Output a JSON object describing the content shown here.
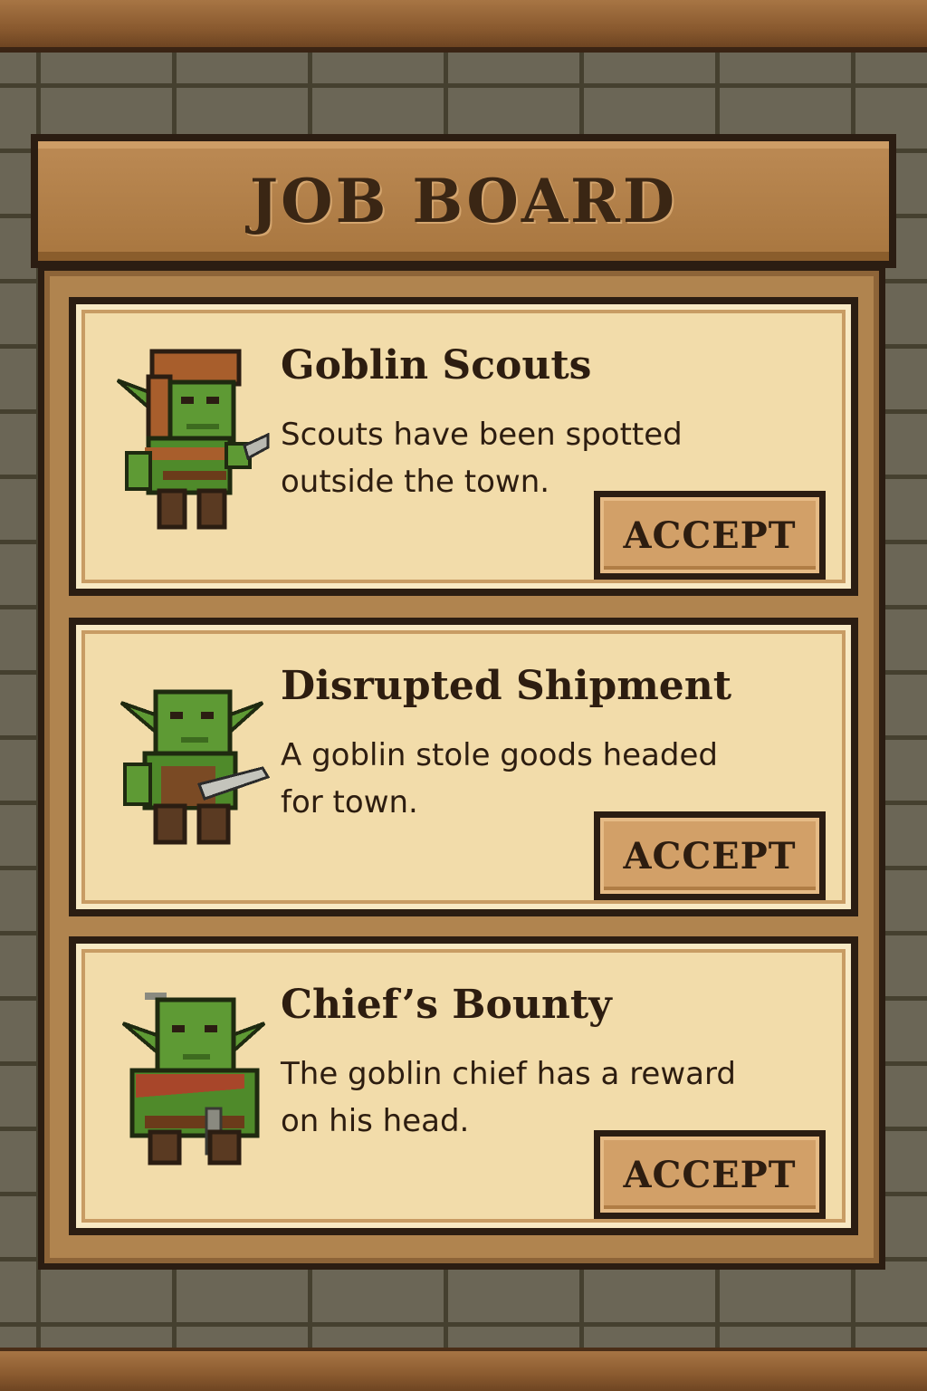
{
  "board": {
    "title": "JOB BOARD"
  },
  "jobs": [
    {
      "title": "Goblin Scouts",
      "description": "Scouts have been spotted outside the town.",
      "accept_label": "ACCEPT",
      "portrait_icon": "hooded-goblin-icon"
    },
    {
      "title": "Disrupted Shipment",
      "description": "A goblin stole goods headed for town.",
      "accept_label": "ACCEPT",
      "portrait_icon": "goblin-with-dagger-icon"
    },
    {
      "title": "Chief’s Bounty",
      "description": "The goblin chief has a reward on his head.",
      "accept_label": "ACCEPT",
      "portrait_icon": "goblin-chief-icon"
    }
  ],
  "colors": {
    "card_background": "#f2dcaa",
    "board_wood": "#b0844f",
    "outline": "#2b1d12",
    "goblin_skin": "#5e9a34",
    "button": "#d2a068"
  }
}
